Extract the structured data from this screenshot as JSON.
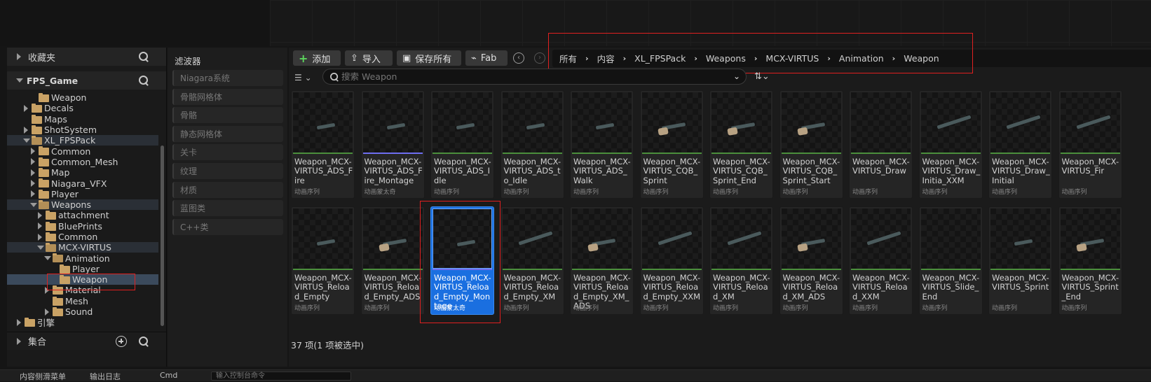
{
  "left_panel": {
    "favorites_label": "收藏夹",
    "project_label": "FPS_Game",
    "tree": [
      {
        "label": "Weapon",
        "depth": 2,
        "expander": "none",
        "state": "normal"
      },
      {
        "label": "Decals",
        "depth": 1,
        "expander": "collapsed",
        "state": "normal"
      },
      {
        "label": "Maps",
        "depth": 1,
        "expander": "none",
        "state": "normal"
      },
      {
        "label": "ShotSystem",
        "depth": 1,
        "expander": "collapsed",
        "state": "normal"
      },
      {
        "label": "XL_FPSPack",
        "depth": 1,
        "expander": "expanded",
        "state": "highlight"
      },
      {
        "label": "Common",
        "depth": 2,
        "expander": "collapsed",
        "state": "normal"
      },
      {
        "label": "Common_Mesh",
        "depth": 2,
        "expander": "collapsed",
        "state": "normal"
      },
      {
        "label": "Map",
        "depth": 2,
        "expander": "collapsed",
        "state": "normal"
      },
      {
        "label": "Niagara_VFX",
        "depth": 2,
        "expander": "collapsed",
        "state": "normal"
      },
      {
        "label": "Player",
        "depth": 2,
        "expander": "collapsed",
        "state": "normal"
      },
      {
        "label": "Weapons",
        "depth": 2,
        "expander": "expanded",
        "state": "highlight"
      },
      {
        "label": "attachment",
        "depth": 3,
        "expander": "collapsed",
        "state": "normal"
      },
      {
        "label": "BluePrints",
        "depth": 3,
        "expander": "collapsed",
        "state": "normal"
      },
      {
        "label": "Common",
        "depth": 3,
        "expander": "collapsed",
        "state": "normal"
      },
      {
        "label": "MCX-VIRTUS",
        "depth": 3,
        "expander": "expanded",
        "state": "highlight"
      },
      {
        "label": "Animation",
        "depth": 4,
        "expander": "expanded",
        "state": "normal"
      },
      {
        "label": "Player",
        "depth": 5,
        "expander": "none",
        "state": "normal"
      },
      {
        "label": "Weapon",
        "depth": 5,
        "expander": "none",
        "state": "selected"
      },
      {
        "label": "Material",
        "depth": 4,
        "expander": "collapsed",
        "state": "normal"
      },
      {
        "label": "Mesh",
        "depth": 4,
        "expander": "none",
        "state": "normal"
      },
      {
        "label": "Sound",
        "depth": 4,
        "expander": "collapsed",
        "state": "normal"
      },
      {
        "label": "引擎",
        "depth": 0,
        "expander": "collapsed",
        "state": "normal"
      }
    ],
    "collections_label": "集合"
  },
  "filter_panel": {
    "title": "滤波器",
    "items": [
      "Niagara系统",
      "骨骼网格体",
      "骨骼",
      "静态网格体",
      "关卡",
      "纹理",
      "材质",
      "蓝图类",
      "C++类"
    ]
  },
  "toolbar": {
    "add_label": "添加",
    "import_label": "导入",
    "save_all_label": "保存所有",
    "fab_label": "Fab"
  },
  "breadcrumb": [
    "所有",
    "内容",
    "XL_FPSPack",
    "Weapons",
    "MCX-VIRTUS",
    "Animation",
    "Weapon"
  ],
  "search": {
    "placeholder": "搜索 Weapon"
  },
  "assets_row1": [
    {
      "name": "Weapon_MCX-VIRTUS_ADS_Fire",
      "type": "动画序列",
      "bar": "sequence",
      "gun": "sm"
    },
    {
      "name": "Weapon_MCX-VIRTUS_ADS_Fire_Montage",
      "type": "动画蒙太奇",
      "bar": "montage",
      "gun": "sm"
    },
    {
      "name": "Weapon_MCX-VIRTUS_ADS_Idle",
      "type": "动画序列",
      "bar": "sequence",
      "gun": "sm"
    },
    {
      "name": "Weapon_MCX-VIRTUS_ADS_to_Idle",
      "type": "动画序列",
      "bar": "sequence",
      "gun": "sm"
    },
    {
      "name": "Weapon_MCX-VIRTUS_ADS_Walk",
      "type": "动画序列",
      "bar": "sequence",
      "gun": "sm"
    },
    {
      "name": "Weapon_MCX-VIRTUS_CQB_Sprint",
      "type": "动画序列",
      "bar": "sequence",
      "gun": "beige"
    },
    {
      "name": "Weapon_MCX-VIRTUS_CQB_Sprint_End",
      "type": "动画序列",
      "bar": "sequence",
      "gun": "beige"
    },
    {
      "name": "Weapon_MCX-VIRTUS_CQB_Sprint_Start",
      "type": "动画序列",
      "bar": "sequence",
      "gun": "beige"
    },
    {
      "name": "Weapon_MCX-VIRTUS_Draw",
      "type": "动画序列",
      "bar": "sequence",
      "gun": "none"
    },
    {
      "name": "Weapon_MCX-VIRTUS_Draw_Initia_XXM",
      "type": "动画序列",
      "bar": "sequence",
      "gun": "long"
    },
    {
      "name": "Weapon_MCX-VIRTUS_Draw_Initial",
      "type": "动画序列",
      "bar": "sequence",
      "gun": "long"
    },
    {
      "name": "Weapon_MCX-VIRTUS_Fir",
      "type": "动画序列",
      "bar": "sequence",
      "gun": "long"
    }
  ],
  "assets_row2": [
    {
      "name": "Weapon_MCX-VIRTUS_Reload_Empty",
      "type": "动画序列",
      "bar": "sequence",
      "gun": "sm"
    },
    {
      "name": "Weapon_MCX-VIRTUS_Reload_Empty_ADS",
      "type": "动画序列",
      "bar": "sequence",
      "gun": "beige"
    },
    {
      "name": "Weapon_MCX-VIRTUS_Reload_Empty_Montage",
      "type": "动画蒙太奇",
      "bar": "montage",
      "gun": "sm",
      "selected": true
    },
    {
      "name": "Weapon_MCX-VIRTUS_Reload_Empty_XM",
      "type": "动画序列",
      "bar": "sequence",
      "gun": "long"
    },
    {
      "name": "Weapon_MCX-VIRTUS_Reload_Empty_XM_ADS",
      "type": "动画序列",
      "bar": "sequence",
      "gun": "beige"
    },
    {
      "name": "Weapon_MCX-VIRTUS_Reload_Empty_XXM",
      "type": "动画序列",
      "bar": "sequence",
      "gun": "long"
    },
    {
      "name": "Weapon_MCX-VIRTUS_Reload_XM",
      "type": "动画序列",
      "bar": "sequence",
      "gun": "long"
    },
    {
      "name": "Weapon_MCX-VIRTUS_Reload_XM_ADS",
      "type": "动画序列",
      "bar": "sequence",
      "gun": "beige"
    },
    {
      "name": "Weapon_MCX-VIRTUS_Reload_XXM",
      "type": "动画序列",
      "bar": "sequence",
      "gun": "long"
    },
    {
      "name": "Weapon_MCX-VIRTUS_Slide_End",
      "type": "动画序列",
      "bar": "sequence",
      "gun": "none"
    },
    {
      "name": "Weapon_MCX-VIRTUS_Sprint",
      "type": "动画序列",
      "bar": "sequence",
      "gun": "sm"
    },
    {
      "name": "Weapon_MCX-VIRTUS_Sprint_End",
      "type": "动画序列",
      "bar": "sequence",
      "gun": "beige"
    }
  ],
  "status_text": "37 项(1 项被选中)",
  "bottom_bar": {
    "tab1": "内容侧滑菜单",
    "tab2": "输出日志",
    "tab3": "Cmd",
    "cmd_placeholder": "输入控制台命令"
  },
  "colors": {
    "accent_red": "#e02020",
    "selection_blue": "#1a6fe0",
    "sequence_bar": "#4b8f3c",
    "montage_bar": "#6e6ef0"
  }
}
